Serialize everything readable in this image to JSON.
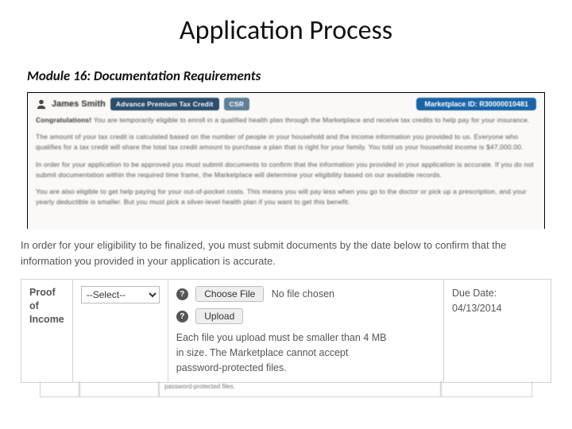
{
  "page": {
    "title": "Application Process",
    "subtitle": "Module 16: Documentation Requirements"
  },
  "panel": {
    "person_name": "James Smith",
    "badge_aptc": "Advance Premium Tax Credit",
    "badge_csr": "CSR",
    "marketplace_id": "Marketplace ID: R30000010481",
    "para1_lead": "Congratulations!",
    "para1": "You are temporarily eligible to enroll in a qualified health plan through the Marketplace and receive tax credits to help pay for your insurance.",
    "para2": "The amount of your tax credit is calculated based on the number of people in your household and the income information you provided to us. Everyone who qualifies for a tax credit will share the total tax credit amount to purchase a plan that is right for your family. You told us your household income is $47,000.00.",
    "para3": "In order for your application to be approved you must submit documents to confirm that the information you provided in your application is accurate. If you do not submit documentation within the required time frame, the Marketplace will determine your eligibility based on our available records.",
    "para4": "You are also eligible to get help paying for your out-of-pocket costs. This means you will pay less when you go to the doctor or pick up a prescription, and your yearly deductible is smaller. But you must pick a silver-level health plan if you want to get this benefit."
  },
  "overlay": {
    "intro": "In order for your eligibility to be finalized, you must submit documents by the date below to confirm that the information you provided in your application is accurate.",
    "proof_label_1": "Proof",
    "proof_label_2": "of",
    "proof_label_3": "Income",
    "select_placeholder": "--Select--",
    "choose_file_label": "Choose File",
    "file_status": "No file chosen",
    "upload_label": "Upload",
    "note": "Each file you upload must be smaller than 4 MB in size. The Marketplace cannot accept password-protected files.",
    "due_label": "Due Date:",
    "due_value": "04/13/2014",
    "help_symbol": "?"
  },
  "stub": {
    "text": "password-protected files."
  }
}
